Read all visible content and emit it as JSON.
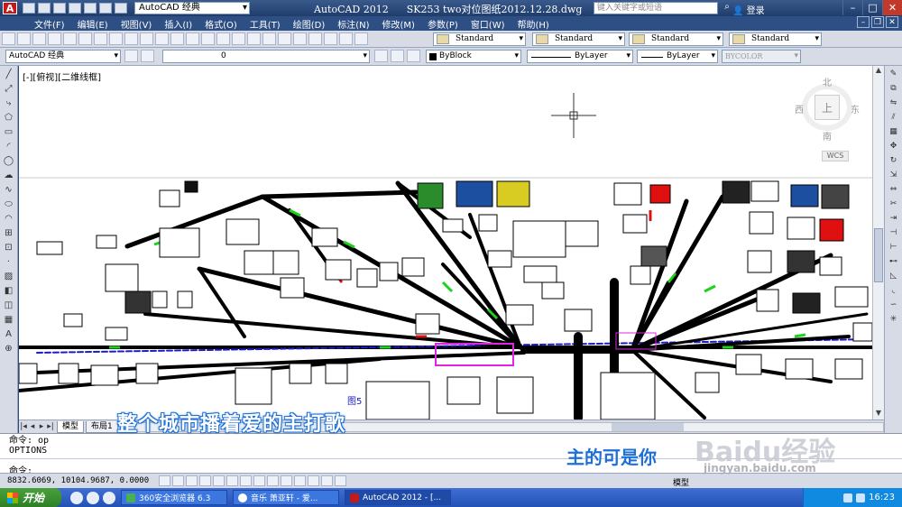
{
  "titlebar": {
    "app_icon": "A",
    "workspace": "AutoCAD 经典",
    "app_name": "AutoCAD 2012",
    "file_name": "SK253 two对位图纸2012.12.28.dwg",
    "search_placeholder": "键入关键字或短语",
    "login": "登录"
  },
  "menubar": {
    "items": [
      "文件(F)",
      "编辑(E)",
      "视图(V)",
      "插入(I)",
      "格式(O)",
      "工具(T)",
      "绘图(D)",
      "标注(N)",
      "修改(M)",
      "参数(P)",
      "窗口(W)",
      "帮助(H)"
    ]
  },
  "styles": {
    "text_style": "Standard",
    "dim_style": "Standard",
    "table_style": "Standard",
    "mleader_style": "Standard"
  },
  "toolbar2": {
    "workspace": "AutoCAD 经典",
    "layer": "0",
    "color": "ByBlock",
    "linetype": "ByLayer",
    "lineweight": "ByLayer",
    "plotstyle": "BYCOLOR"
  },
  "viewport": {
    "label": "[-][俯视][二维线框]",
    "viewcube": {
      "north": "北",
      "south": "南",
      "east": "东",
      "west": "西",
      "top": "上"
    },
    "wcs": "WCS"
  },
  "tabs": [
    "模型",
    "布局1"
  ],
  "command": {
    "history": [
      "命令: op",
      "OPTIONS"
    ],
    "prompt": "命令:"
  },
  "status": {
    "coords": "8832.6069, 10104.9687, 0.0000",
    "model": "模型"
  },
  "overlay": {
    "subtitle_line1": "整个城市播着爱的主打歌",
    "subtitle_line2": "主的可是你",
    "watermark": "Baidu经验",
    "watermark_url": "jingyan.baidu.com"
  },
  "drawing": {
    "figure_label": "图5"
  },
  "taskbar": {
    "start": "开始",
    "tasks": [
      "360安全浏览器 6.3",
      "音乐 萧亚轩 - 爱...",
      "AutoCAD 2012 - [..."
    ],
    "clock": "16:23"
  }
}
